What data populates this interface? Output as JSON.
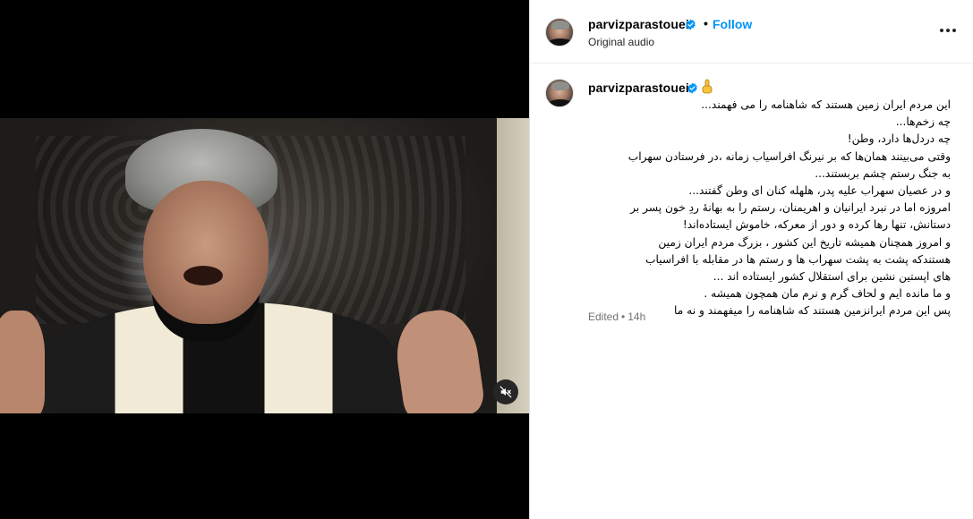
{
  "post": {
    "username": "parvizparastouei",
    "follow_label": "Follow",
    "separator": "•",
    "audio_label": "Original audio"
  },
  "caption": {
    "username": "parvizparastouei",
    "lines": [
      "این مردم ایران زمین هستند که شاهنامه را می فهمند...",
      "چه زخم‌ها...",
      "چه دردل‌ها دارد، وطن!",
      "وقتی می‌بینند همان‌ها که بر نیرنگ افراسیاب زمانه ،در فرستادن سهراب",
      "به جنگ رستم چشم بربستند...",
      "و در عصیان سهراب علیه پدر، هلهله کنان ای وطن گفتند...",
      "امروزه اما در نبرد ایرانیان و اهریمنان، رستم را به بهانهٔ ردِ خون پسر بر",
      "دستانش، تنها رها کرده و دور از معرکه، خاموش ایستاده‌اند!",
      "و امروز همچنان همیشه تاریخ این کشور ، بزرگ مردم ایران زمین",
      "هستندکه پشت به پشت سهراب ها و رستم ها در مقابله با افراسیاب",
      "های اپستین نشین برای استقلال کشور ایستاده اند ...",
      "و ما مانده ایم و لحاف گرم و نرم مان همچون همیشه .",
      "پس این مردم ایرانزمین هستند که شاهنامه را میفهمند و نه ما"
    ],
    "edited_label": "Edited",
    "time_separator": "•",
    "time_ago": "14h"
  },
  "colors": {
    "follow": "#0095f6",
    "verified": "#0095f6",
    "meta_text": "#737373",
    "video_bg": "#000000"
  },
  "icons": {
    "mute": "speaker-muted-icon",
    "more": "more-options-icon",
    "verified": "verified-badge-icon",
    "emoji": "pointing-down-hand-emoji"
  }
}
